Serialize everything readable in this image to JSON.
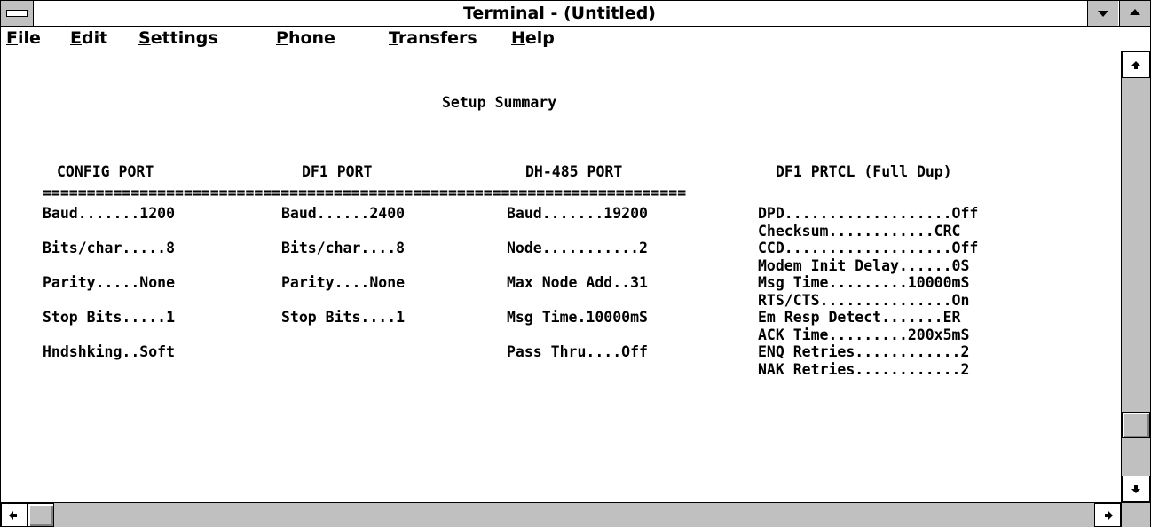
{
  "window": {
    "title": "Terminal - (Untitled)"
  },
  "menu": {
    "file": {
      "accel": "F",
      "rest": "ile"
    },
    "edit": {
      "accel": "E",
      "rest": "dit"
    },
    "settings": {
      "accel": "S",
      "rest": "ettings"
    },
    "phone": {
      "accel": "P",
      "rest": "hone"
    },
    "transfers": {
      "accel": "T",
      "rest": "ransfers"
    },
    "help": {
      "accel": "H",
      "rest": "elp"
    }
  },
  "terminal": {
    "heading": "Setup Summary",
    "columns": {
      "config_port": "CONFIG PORT",
      "df1_port": "DF1 PORT",
      "dh485_port": "DH-485 PORT",
      "df1_protocol": "DF1 PRTCL (Full Dup)"
    },
    "separator": "=========================================================================",
    "config_port": [
      "Baud.......1200",
      "",
      "Bits/char.....8",
      "",
      "Parity.....None",
      "",
      "Stop Bits.....1",
      "",
      "Hndshking..Soft"
    ],
    "df1_port": [
      "Baud......2400",
      "",
      "Bits/char....8",
      "",
      "Parity....None",
      "",
      "Stop Bits....1"
    ],
    "dh485_port": [
      "Baud.......19200",
      "",
      "Node...........2",
      "",
      "Max Node Add..31",
      "",
      "Msg Time.10000mS",
      "",
      "Pass Thru....Off"
    ],
    "df1_protocol": [
      "DPD...................Off",
      "Checksum............CRC",
      "CCD...................Off",
      "Modem Init Delay......0S",
      "Msg Time.........10000mS",
      "RTS/CTS...............On",
      "Em Resp Detect.......ER",
      "ACK Time.........200x5mS",
      "ENQ Retries............2",
      "NAK Retries............2"
    ]
  },
  "icons": {
    "system_menu": "system-menu-icon",
    "minimize": "minimize-icon",
    "maximize": "maximize-icon",
    "scroll_up": "scroll-up-arrow-icon",
    "scroll_down": "scroll-down-arrow-icon",
    "scroll_left": "scroll-left-arrow-icon",
    "scroll_right": "scroll-right-arrow-icon"
  },
  "scrollbars": {
    "vertical_position": 0.9,
    "horizontal_position": 0.0
  }
}
